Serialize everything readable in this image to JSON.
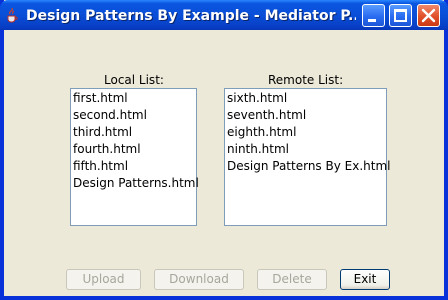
{
  "window": {
    "title": "Design Patterns By Example - Mediator P...",
    "icon": "java-cup-icon"
  },
  "local": {
    "label": "Local List:",
    "items": [
      "first.html",
      "second.html",
      "third.html",
      "fourth.html",
      "fifth.html",
      "Design Patterns.html"
    ]
  },
  "remote": {
    "label": "Remote List:",
    "items": [
      "sixth.html",
      "seventh.html",
      "eighth.html",
      "ninth.html",
      "Design Patterns By Ex.html"
    ]
  },
  "buttons": {
    "upload": "Upload",
    "download": "Download",
    "delete": "Delete",
    "exit": "Exit"
  },
  "colors": {
    "titlebar": "#0a4fd8",
    "window_bg": "#ece9d8",
    "close": "#e0502a"
  }
}
